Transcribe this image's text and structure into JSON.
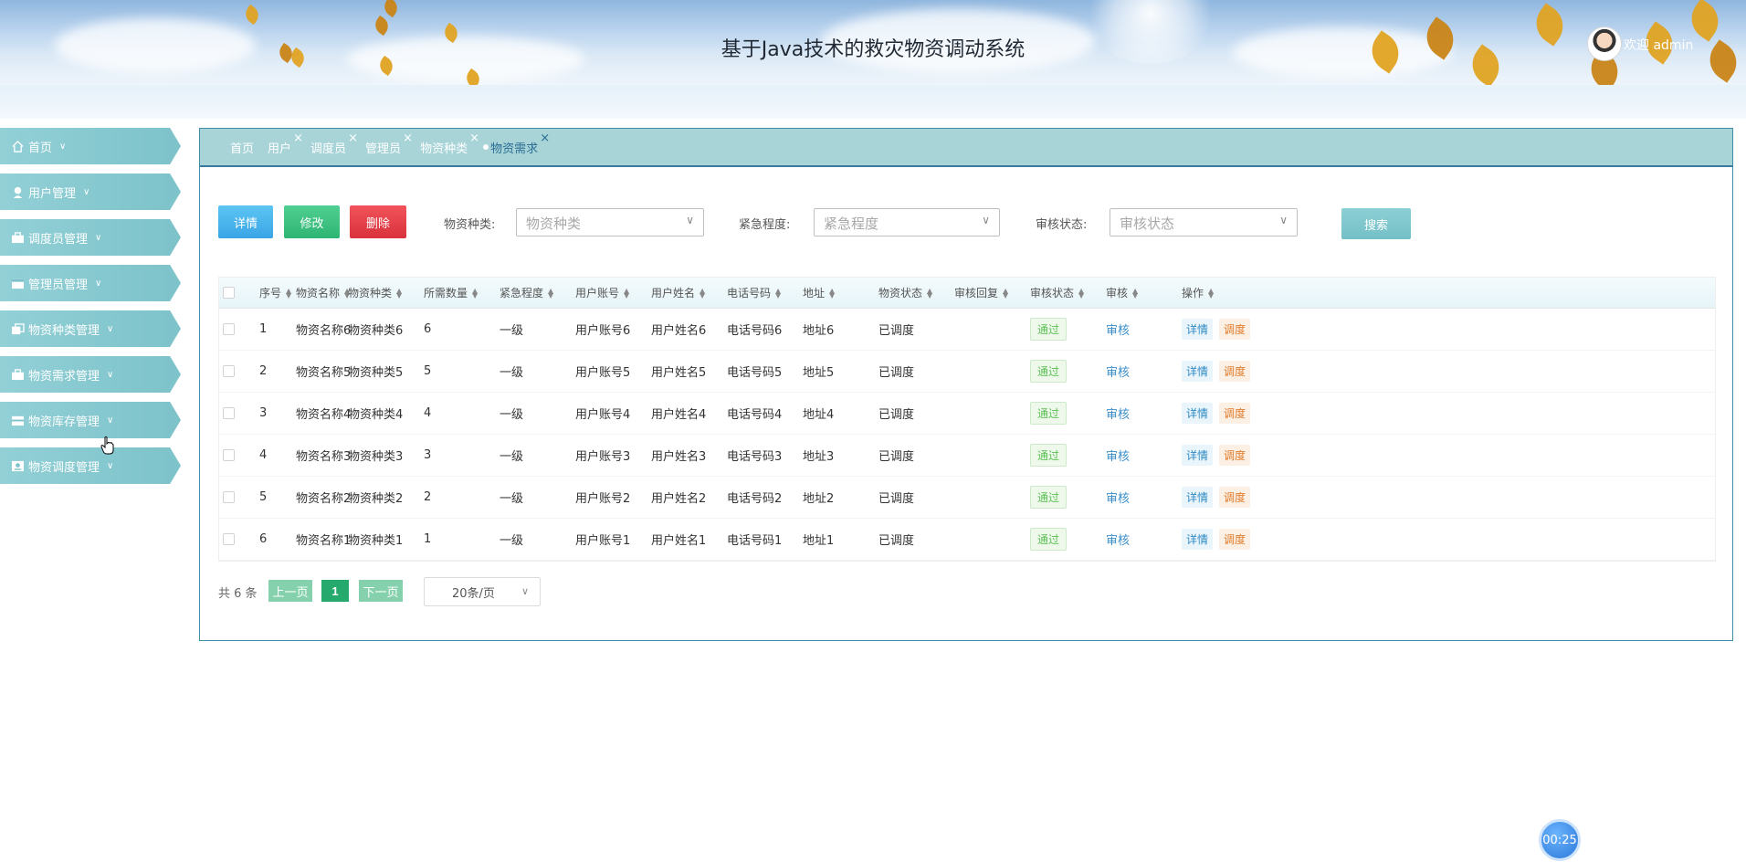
{
  "app": {
    "title": "基于Java技术的救灾物资调动系统",
    "welcome": "欢迎 admin"
  },
  "sidebar": {
    "items": [
      {
        "label": "首页",
        "icon": "home-icon"
      },
      {
        "label": "用户管理",
        "icon": "user-icon"
      },
      {
        "label": "调度员管理",
        "icon": "dispatcher-icon"
      },
      {
        "label": "管理员管理",
        "icon": "admin-icon"
      },
      {
        "label": "物资种类管理",
        "icon": "category-icon"
      },
      {
        "label": "物资需求管理",
        "icon": "demand-icon"
      },
      {
        "label": "物资库存管理",
        "icon": "inventory-icon"
      },
      {
        "label": "物资调度管理",
        "icon": "dispatch-icon"
      }
    ]
  },
  "tabs": [
    {
      "label": "首页",
      "closable": false
    },
    {
      "label": "用户",
      "closable": true
    },
    {
      "label": "调度员",
      "closable": true
    },
    {
      "label": "管理员",
      "closable": true
    },
    {
      "label": "物资种类",
      "closable": true
    },
    {
      "label": "物资需求",
      "closable": true,
      "active": true
    }
  ],
  "tab_close": "×",
  "toolbar": {
    "detail": "详情",
    "edit": "修改",
    "delete": "删除",
    "search": "搜索"
  },
  "filters": {
    "category_label": "物资种类:",
    "category_placeholder": "物资种类",
    "urgency_label": "紧急程度:",
    "urgency_placeholder": "紧急程度",
    "status_label": "审核状态:",
    "status_placeholder": "审核状态"
  },
  "table": {
    "headers": [
      "序号",
      "物资名称",
      "物资种类",
      "所需数量",
      "紧急程度",
      "用户账号",
      "用户姓名",
      "电话号码",
      "地址",
      "物资状态",
      "审核回复",
      "审核状态",
      "审核",
      "操作"
    ],
    "rows": [
      [
        "1",
        "物资名称6",
        "物资种类6",
        "6",
        "一级",
        "用户账号6",
        "用户姓名6",
        "电话号码6",
        "地址6",
        "已调度",
        "",
        "通过",
        "审核"
      ],
      [
        "2",
        "物资名称5",
        "物资种类5",
        "5",
        "一级",
        "用户账号5",
        "用户姓名5",
        "电话号码5",
        "地址5",
        "已调度",
        "",
        "通过",
        "审核"
      ],
      [
        "3",
        "物资名称4",
        "物资种类4",
        "4",
        "一级",
        "用户账号4",
        "用户姓名4",
        "电话号码4",
        "地址4",
        "已调度",
        "",
        "通过",
        "审核"
      ],
      [
        "4",
        "物资名称3",
        "物资种类3",
        "3",
        "一级",
        "用户账号3",
        "用户姓名3",
        "电话号码3",
        "地址3",
        "已调度",
        "",
        "通过",
        "审核"
      ],
      [
        "5",
        "物资名称2",
        "物资种类2",
        "2",
        "一级",
        "用户账号2",
        "用户姓名2",
        "电话号码2",
        "地址2",
        "已调度",
        "",
        "通过",
        "审核"
      ],
      [
        "6",
        "物资名称1",
        "物资种类1",
        "1",
        "一级",
        "用户账号1",
        "用户姓名1",
        "电话号码1",
        "地址1",
        "已调度",
        "",
        "通过",
        "审核"
      ]
    ],
    "op_detail": "详情",
    "op_dispatch": "调度"
  },
  "pagination": {
    "total": "共 6 条",
    "prev": "上一页",
    "page": "1",
    "next": "下一页",
    "page_size": "20条/页"
  },
  "timer": "00:25",
  "colors": {
    "sidebar": "#86c8cf",
    "tabbar": "#a8d4d8",
    "detail_btn": "#3aa5e6",
    "edit_btn": "#2fb573",
    "delete_btn": "#d9323c",
    "pass_badge": "#5bbf52"
  }
}
